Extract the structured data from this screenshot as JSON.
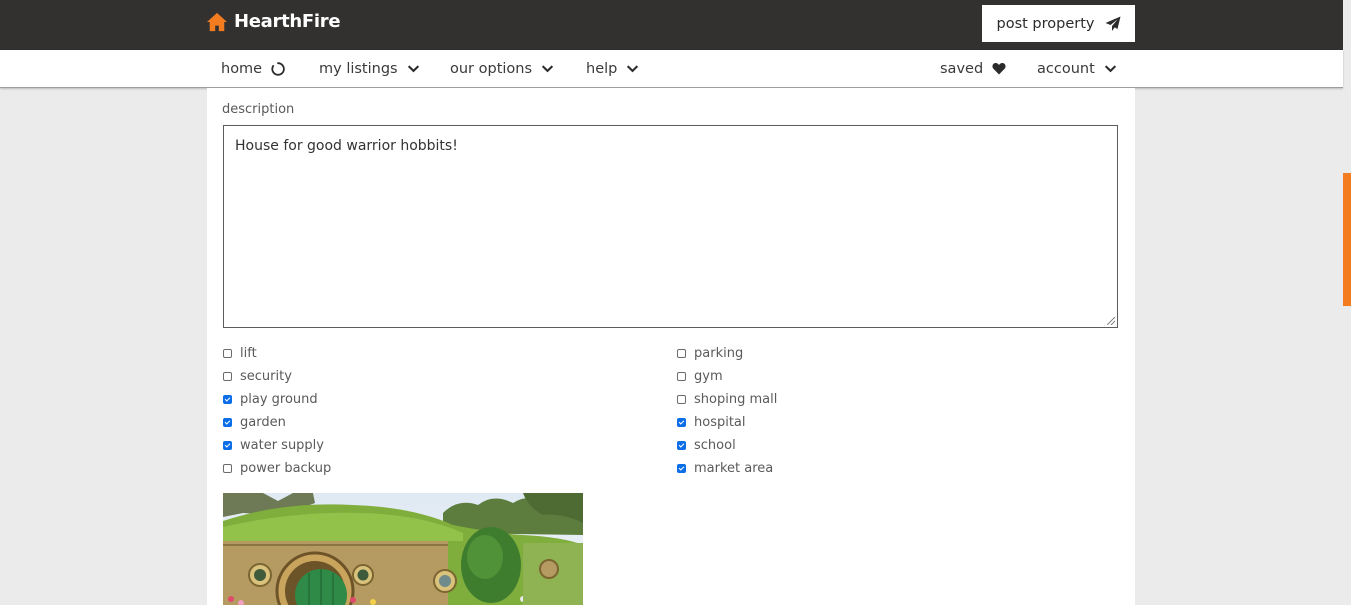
{
  "brand": {
    "name": "HearthFire"
  },
  "header": {
    "post_property_label": "post property"
  },
  "nav": {
    "home": "home",
    "my_listings": "my listings",
    "our_options": "our options",
    "help": "help",
    "saved": "saved",
    "account": "account"
  },
  "form": {
    "description_label": "description",
    "description_value": "House for good warrior hobbits!"
  },
  "amenities": [
    {
      "label": "lift",
      "checked": false
    },
    {
      "label": "security",
      "checked": false
    },
    {
      "label": "play ground",
      "checked": true
    },
    {
      "label": "garden",
      "checked": true
    },
    {
      "label": "water supply",
      "checked": true
    },
    {
      "label": "power backup",
      "checked": false
    },
    {
      "label": "parking",
      "checked": false
    },
    {
      "label": "gym",
      "checked": false
    },
    {
      "label": "shoping mall",
      "checked": false
    },
    {
      "label": "hospital",
      "checked": true
    },
    {
      "label": "school",
      "checked": true
    },
    {
      "label": "market area",
      "checked": true
    }
  ],
  "colors": {
    "header_bg": "#323130",
    "brand_accent": "#f47c20",
    "checkbox_checked": "#0b6ee8"
  },
  "icons": {
    "brand": "house-icon",
    "post": "paper-plane-icon",
    "home": "spinner-icon",
    "dropdown": "chevron-down-icon",
    "saved": "heart-icon"
  }
}
